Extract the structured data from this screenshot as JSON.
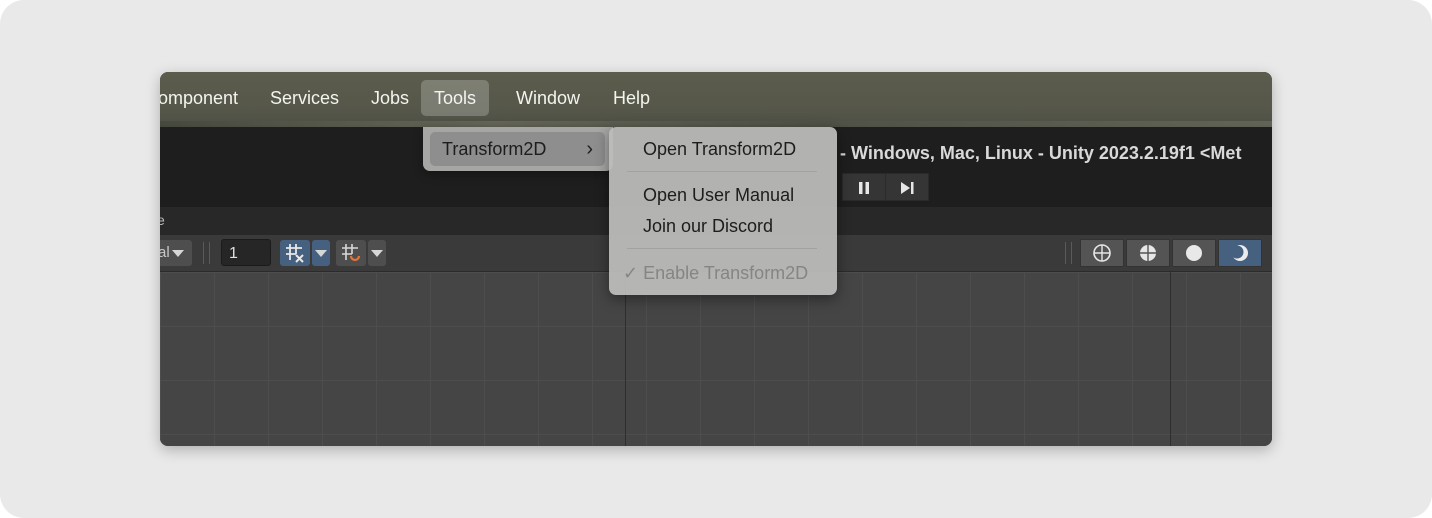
{
  "menubar": {
    "items": [
      {
        "label": "omponent"
      },
      {
        "label": "Services"
      },
      {
        "label": "Jobs"
      },
      {
        "label": "Tools"
      },
      {
        "label": "Window"
      },
      {
        "label": "Help"
      }
    ]
  },
  "titlebar": {
    "title": "- Windows, Mac, Linux - Unity 2023.2.19f1 <Met"
  },
  "playbar": {
    "pause_icon": "pause-icon",
    "step_icon": "step-forward-icon"
  },
  "tabstrip": {
    "label": "e"
  },
  "toolbar": {
    "view_dropdown": "al",
    "grid_size_value": "1"
  },
  "tools_menu": {
    "items": [
      {
        "label": "Transform2D",
        "submenu_arrow": "›"
      }
    ]
  },
  "transform2d_submenu": {
    "open": "Open Transform2D",
    "manual": "Open User Manual",
    "discord": "Join our Discord",
    "enable_check": "✓",
    "enable": "Enable Transform2D"
  },
  "colors": {
    "menubar_bg": "#5a5b4b",
    "selected_shading": "#46607f"
  }
}
